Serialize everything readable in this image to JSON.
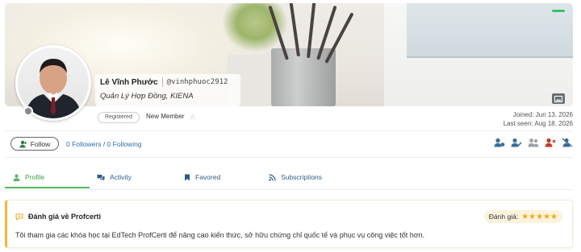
{
  "profile": {
    "name": "Lê Vĩnh Phước",
    "handle": "@vinhphuoc2912",
    "role": "Quản Lý Hợp Đồng, KIENA",
    "status_badge": "Registered",
    "member_label": "New Member",
    "joined": "Joined: Jun 13, 2026",
    "last_seen": "Last seen: Aug 18, 2026"
  },
  "social": {
    "follow_label": "Follow",
    "follow_stats": "0 Followers / 0 Following"
  },
  "tabs": [
    {
      "label": "Profile",
      "icon": "user-icon",
      "active": true
    },
    {
      "label": "Activity",
      "icon": "chat-icon",
      "active": false
    },
    {
      "label": "Favored",
      "icon": "bookmark-icon",
      "active": false
    },
    {
      "label": "Subscriptions",
      "icon": "rss-icon",
      "active": false
    }
  ],
  "review": {
    "title": "Đánh giá về Profcerti",
    "rating_label": "Đánh giá:",
    "stars": 5,
    "text": "Tôi tham gia các khóa học tại EdTech ProfCerti để nâng cao kiến thức, sở hữu chứng chỉ quốc tế và phục vụ công việc tốt hơn."
  },
  "colors": {
    "accent_green": "#51b860",
    "link_blue": "#2e6fa8",
    "tab_blue": "#2c5d86",
    "star_gold": "#f2a91a",
    "review_border": "#f4b73a",
    "status_dash": "#36c26f"
  }
}
